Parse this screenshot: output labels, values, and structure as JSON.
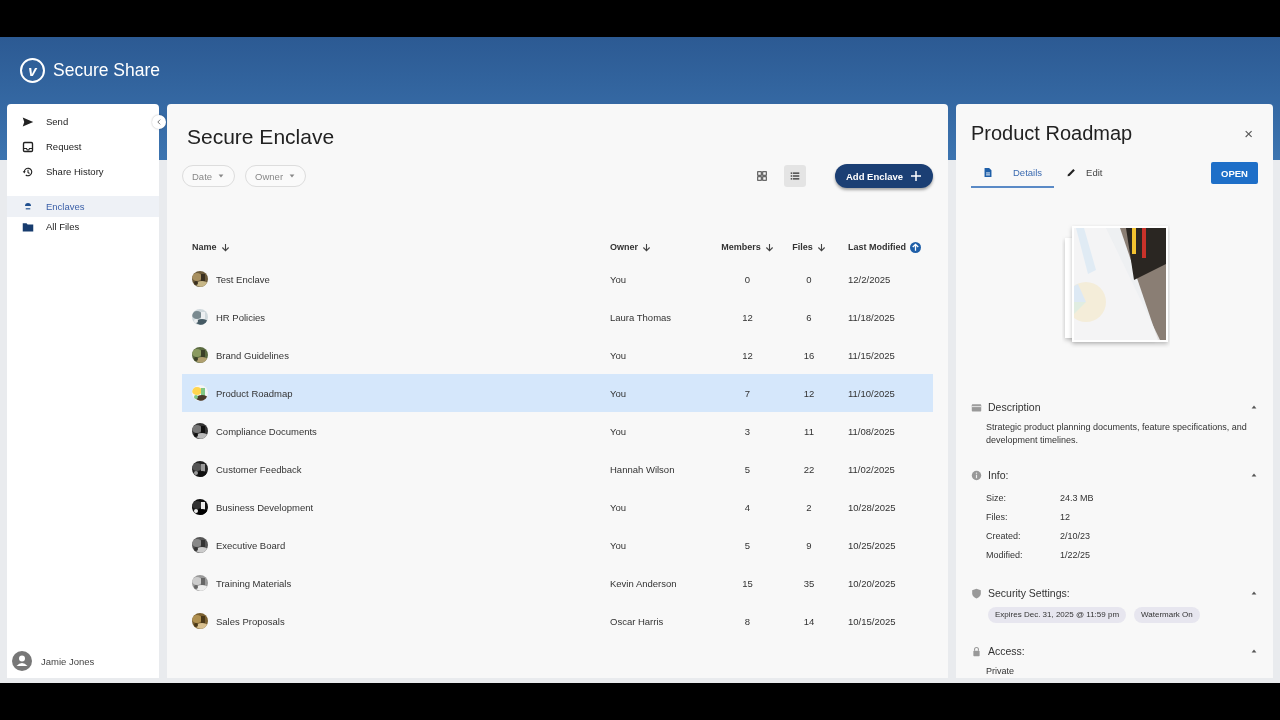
{
  "app": {
    "logo_letter": "v",
    "title": "Secure Share"
  },
  "sidebar": {
    "groups": [
      [
        {
          "label": "Send",
          "selected": false
        },
        {
          "label": "Request",
          "selected": false
        },
        {
          "label": "Share History",
          "selected": false
        }
      ],
      [
        {
          "label": "Enclaves",
          "selected": true
        },
        {
          "label": "All Files",
          "selected": false
        }
      ]
    ],
    "user": {
      "name": "Jamie Jones"
    }
  },
  "main": {
    "title": "Secure Enclave",
    "filters": [
      {
        "label": "Date"
      },
      {
        "label": "Owner"
      }
    ],
    "views": [
      {
        "selected": false
      },
      {
        "selected": true
      }
    ],
    "add_button": "Add Enclave",
    "columns": [
      {
        "label": "Name",
        "active": false,
        "ascending": false
      },
      {
        "label": "Owner",
        "active": false,
        "ascending": false
      },
      {
        "label": "Members",
        "active": false,
        "ascending": false
      },
      {
        "label": "Files",
        "active": false,
        "ascending": false
      },
      {
        "label": "Last Modified",
        "active": true,
        "ascending": true
      }
    ],
    "rows": [
      {
        "name": "Test Enclave",
        "owner": "You",
        "members": "0",
        "files": "0",
        "modified": "12/2/2025",
        "selected": false
      },
      {
        "name": "HR Policies",
        "owner": "Laura Thomas",
        "members": "12",
        "files": "6",
        "modified": "11/18/2025",
        "selected": false
      },
      {
        "name": "Brand Guidelines",
        "owner": "You",
        "members": "12",
        "files": "16",
        "modified": "11/15/2025",
        "selected": false
      },
      {
        "name": "Product Roadmap",
        "owner": "You",
        "members": "7",
        "files": "12",
        "modified": "11/10/2025",
        "selected": true
      },
      {
        "name": "Compliance Documents",
        "owner": "You",
        "members": "3",
        "files": "11",
        "modified": "11/08/2025",
        "selected": false
      },
      {
        "name": "Customer Feedback",
        "owner": "Hannah Wilson",
        "members": "5",
        "files": "22",
        "modified": "11/02/2025",
        "selected": false
      },
      {
        "name": "Business Development",
        "owner": "You",
        "members": "4",
        "files": "2",
        "modified": "10/28/2025",
        "selected": false
      },
      {
        "name": "Executive Board",
        "owner": "You",
        "members": "5",
        "files": "9",
        "modified": "10/25/2025",
        "selected": false
      },
      {
        "name": "Training Materials",
        "owner": "Kevin Anderson",
        "members": "15",
        "files": "35",
        "modified": "10/20/2025",
        "selected": false
      },
      {
        "name": "Sales Proposals",
        "owner": "Oscar Harris",
        "members": "8",
        "files": "14",
        "modified": "10/15/2025",
        "selected": false
      }
    ]
  },
  "detail": {
    "title": "Product Roadmap",
    "close": "×",
    "tabs": [
      {
        "label": "Details",
        "selected": true
      },
      {
        "label": "Edit",
        "selected": false
      }
    ],
    "open_button": "OPEN",
    "sections": [
      {
        "kind": "text",
        "title": "Description",
        "expanded": true,
        "text": "Strategic product planning documents, feature specifications, and development timelines."
      },
      {
        "kind": "fields",
        "title": "Info:",
        "expanded": true,
        "fields": [
          {
            "label": "Size:",
            "value": "24.3 MB"
          },
          {
            "label": "Files:",
            "value": "12"
          },
          {
            "label": "Created:",
            "value": "2/10/23"
          },
          {
            "label": "Modified:",
            "value": "1/22/25"
          }
        ]
      },
      {
        "kind": "chips",
        "title": "Security Settings:",
        "expanded": true,
        "chips": [
          "Expires Dec. 31, 2025 @ 11:59 pm",
          "Watermark On"
        ]
      },
      {
        "kind": "text",
        "title": "Access:",
        "expanded": true,
        "text": "Private"
      }
    ]
  }
}
